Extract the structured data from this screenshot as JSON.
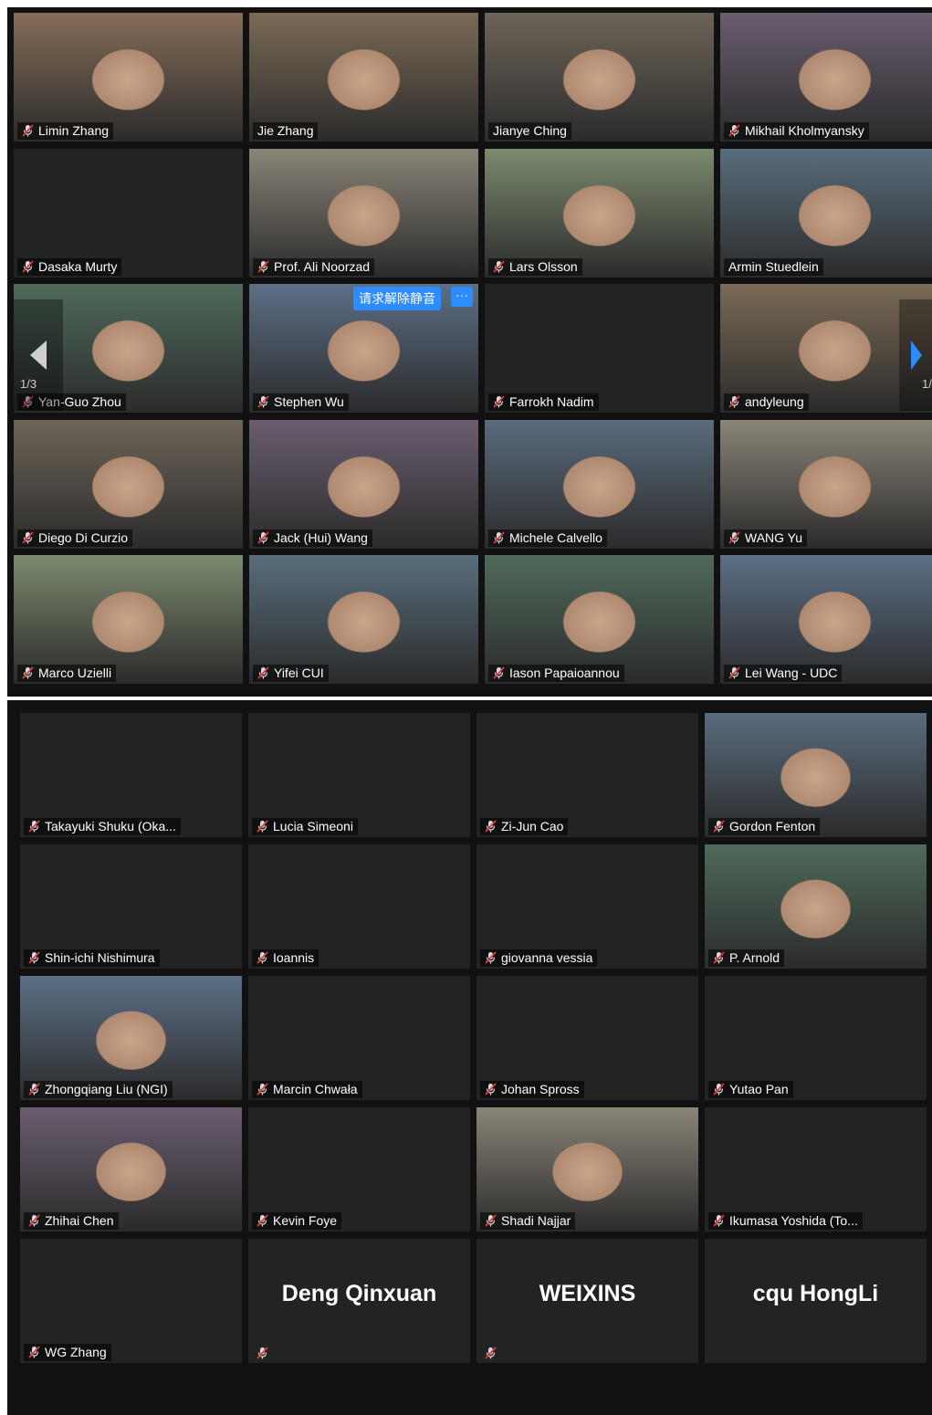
{
  "gallery_page_indicator": "1/3",
  "gallery_page_indicator_right": "1/",
  "unmute_request_label": "请求解除静音",
  "more_label": "···",
  "top_grid": [
    {
      "name": "Limin Zhang",
      "muted": true,
      "video": true
    },
    {
      "name": "Jie Zhang",
      "muted": false,
      "video": true,
      "active": true
    },
    {
      "name": "Jianye Ching",
      "muted": false,
      "video": true
    },
    {
      "name": "Mikhail Kholmyansky",
      "muted": true,
      "video": true
    },
    {
      "name": "Dasaka Murty",
      "muted": true,
      "video": false
    },
    {
      "name": "Prof. Ali Noorzad",
      "muted": true,
      "video": true
    },
    {
      "name": "Lars Olsson",
      "muted": true,
      "video": true
    },
    {
      "name": "Armin Stuedlein",
      "muted": false,
      "video": true
    },
    {
      "name": "Yan-Guo Zhou",
      "muted": true,
      "video": true
    },
    {
      "name": "Stephen Wu",
      "muted": true,
      "video": true
    },
    {
      "name": "Farrokh Nadim",
      "muted": true,
      "video": false
    },
    {
      "name": "andyleung",
      "muted": true,
      "video": true
    },
    {
      "name": "Diego Di Curzio",
      "muted": true,
      "video": true
    },
    {
      "name": "Jack (Hui) Wang",
      "muted": true,
      "video": true
    },
    {
      "name": "Michele Calvello",
      "muted": true,
      "video": true
    },
    {
      "name": "WANG Yu",
      "muted": true,
      "video": true
    },
    {
      "name": "Marco Uzielli",
      "muted": true,
      "video": true
    },
    {
      "name": "Yifei CUI",
      "muted": true,
      "video": true
    },
    {
      "name": "Iason Papaioannou",
      "muted": true,
      "video": true
    },
    {
      "name": "Lei Wang - UDC",
      "muted": true,
      "video": true
    }
  ],
  "bottom_grid": [
    {
      "name": "Takayuki Shuku (Oka...",
      "muted": true,
      "video": false
    },
    {
      "name": "Lucia Simeoni",
      "muted": true,
      "video": false
    },
    {
      "name": "Zi-Jun Cao",
      "muted": true,
      "video": false
    },
    {
      "name": "Gordon Fenton",
      "muted": true,
      "video": true
    },
    {
      "name": "Shin-ichi Nishimura",
      "muted": true,
      "video": false
    },
    {
      "name": "Ioannis",
      "muted": true,
      "video": false
    },
    {
      "name": "giovanna vessia",
      "muted": true,
      "video": false
    },
    {
      "name": "P. Arnold",
      "muted": true,
      "video": true
    },
    {
      "name": "Zhongqiang Liu (NGI)",
      "muted": true,
      "video": true
    },
    {
      "name": "Marcin Chwała",
      "muted": true,
      "video": false
    },
    {
      "name": "Johan Spross",
      "muted": true,
      "video": false
    },
    {
      "name": "Yutao Pan",
      "muted": true,
      "video": false
    },
    {
      "name": "Zhihai Chen",
      "muted": true,
      "video": true
    },
    {
      "name": "Kevin Foye",
      "muted": true,
      "video": false
    },
    {
      "name": "Shadi Najjar",
      "muted": true,
      "video": true
    },
    {
      "name": "Ikumasa Yoshida (To...",
      "muted": true,
      "video": false
    },
    {
      "name": "WG Zhang",
      "muted": true,
      "video": false
    },
    {
      "name": "",
      "big_name": "Deng Qinxuan",
      "muted": true,
      "video": false
    },
    {
      "name": "",
      "big_name": "WEIXINS",
      "muted": true,
      "video": false
    },
    {
      "name": "",
      "big_name": "cqu HongLi",
      "muted": false,
      "video": false
    }
  ]
}
